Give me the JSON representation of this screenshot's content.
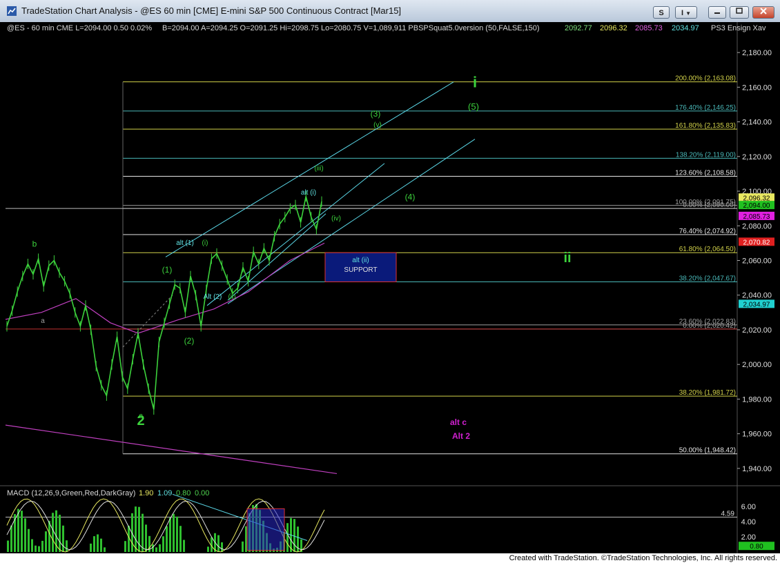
{
  "window": {
    "title": "TradeStation Chart Analysis - @ES 60 min [CME] E-mini S&P 500 Continuous Contract [Mar15]",
    "buttons": [
      {
        "name": "symbol-button",
        "label": "S"
      },
      {
        "name": "indicator-button",
        "label": "I"
      }
    ]
  },
  "header": [
    {
      "text": "@ES - 60 min  CME  L=2094.00  0.50   0.02%",
      "color": "#d8d8d8"
    },
    {
      "text": "B=2094.00  A=2094.25  O=2091.25  Hi=2098.75  Lo=2080.75  V=1,089,911  PBSPSquat5.0version (50,FALSE,150)",
      "color": "#d8d8d8"
    },
    {
      "text": "2092.77",
      "color": "#7fe07f"
    },
    {
      "text": "2096.32",
      "color": "#e8e860"
    },
    {
      "text": "2085.73",
      "color": "#e060e0"
    },
    {
      "text": "2034.97",
      "color": "#60e0e0"
    },
    {
      "text": "PS3 Ensign Xav",
      "color": "#d8d8d8"
    }
  ],
  "macd_header": [
    {
      "text": "MACD (12,26,9,Green,Red,DarkGray)",
      "color": "#d8d8d8"
    },
    {
      "text": "1.90",
      "color": "#e8e860"
    },
    {
      "text": "1.09",
      "color": "#60e0e0"
    },
    {
      "text": "0.80",
      "color": "#4fd24f"
    },
    {
      "text": "0.00",
      "color": "#4fd24f"
    }
  ],
  "footer": "Created with TradeStation. ©TradeStation Technologies, Inc. All rights reserved.",
  "chart_data": {
    "type": "line",
    "series": [
      {
        "values": [
          2022,
          2031,
          2042,
          2051,
          2058,
          2052,
          2061,
          2045,
          2057,
          2060,
          2053,
          2048,
          2041,
          2030,
          2022,
          2034,
          2020,
          1999,
          1988,
          1982,
          2000,
          2016,
          1993,
          1986,
          2003,
          2018,
          2000,
          1986,
          1974,
          2013,
          2024,
          2035,
          2046,
          2044,
          2030,
          2051,
          2040,
          2022,
          2043,
          2061,
          2064,
          2057,
          2049,
          2041,
          2044,
          2056,
          2048,
          2065,
          2058,
          2067,
          2060,
          2074,
          2081,
          2085,
          2090,
          2092,
          2082,
          2097,
          2085,
          2078,
          2094
        ],
        "color": "#3cd23c"
      }
    ],
    "ylim": [
      1930,
      2192
    ],
    "y_ticks": [
      "2,180.00",
      "2,160.00",
      "2,140.00",
      "2,120.00",
      "2,100.00",
      "2,080.00",
      "2,060.00",
      "2,040.00",
      "2,020.00",
      "2,000.00",
      "1,980.00",
      "1,960.00",
      "1,940.00"
    ],
    "fib_levels": [
      {
        "label": "200.00% (2,163.08)",
        "value": 2163.08,
        "color": "#d2d24a"
      },
      {
        "label": "176.40% (2,146.25)",
        "value": 2146.25,
        "color": "#4ab9b9"
      },
      {
        "label": "161.80% (2,135.83)",
        "value": 2135.83,
        "color": "#d2d24a"
      },
      {
        "label": "138.20% (2,119.00)",
        "value": 2119.0,
        "color": "#4ab9b9"
      },
      {
        "label": "123.60% (2,108.58)",
        "value": 2108.58,
        "color": "#e6e6e6"
      },
      {
        "label": "100.00% (2,091.75)",
        "value": 2091.75,
        "color": "#a0a0a0"
      },
      {
        "label": "0.00% (2,090.00)",
        "value": 2090.0,
        "color": "#a0a0a0"
      },
      {
        "label": "76.40% (2,074.92)",
        "value": 2074.92,
        "color": "#e6e6e6"
      },
      {
        "label": "61.80% (2,064.50)",
        "value": 2064.5,
        "color": "#d2d24a"
      },
      {
        "label": "38.20% (2,047.67)",
        "value": 2047.67,
        "color": "#4ab9b9"
      },
      {
        "label": "23.60% (2,022.83)",
        "value": 2022.83,
        "color": "#a0a0a0"
      },
      {
        "label": "0.00% (2,020.42)",
        "value": 2020.42,
        "color": "#a0a0a0"
      },
      {
        "label": "38.20% (1,981.72)",
        "value": 1981.72,
        "color": "#d2d24a"
      },
      {
        "label": "50.00% (1,948.42)",
        "value": 1948.42,
        "color": "#e6e6e6"
      }
    ],
    "price_tags": [
      {
        "text": "2,096.32",
        "value": 2096.32,
        "bg": "#e8e860",
        "fg": "#000"
      },
      {
        "text": "2,094.00",
        "value": 2092.0,
        "bg": "#20c020",
        "fg": "#000"
      },
      {
        "text": "2,085.73",
        "value": 2085.73,
        "bg": "#e020e0",
        "fg": "#000"
      },
      {
        "text": "2,070.82",
        "value": 2070.82,
        "bg": "#e02020",
        "fg": "#fff"
      },
      {
        "text": "2,034.97",
        "value": 2034.97,
        "bg": "#20d0d0",
        "fg": "#000"
      }
    ],
    "wave_labels": [
      {
        "text": "i",
        "value": 2160,
        "color": "#3cd23c"
      },
      {
        "text": "(5)",
        "value": 2147,
        "color": "#3cd23c"
      },
      {
        "text": "(3)",
        "value": 2143,
        "color": "#3cd23c"
      },
      {
        "text": "(v)",
        "value": 2137,
        "color": "#3cd23c"
      },
      {
        "text": "(iii)",
        "value": 2112,
        "color": "#3cd23c"
      },
      {
        "text": "alt (i)",
        "value": 2098,
        "color": "#60e0e0"
      },
      {
        "text": "(4)",
        "value": 2095,
        "color": "#3cd23c"
      },
      {
        "text": "(iv)",
        "value": 2083,
        "color": "#3cd23c"
      },
      {
        "text": "b",
        "value": 2068,
        "color": "#3cd23c"
      },
      {
        "text": "alt (1)",
        "value": 2069,
        "color": "#60e0e0"
      },
      {
        "text": "(i)",
        "value": 2069,
        "color": "#3cd23c"
      },
      {
        "text": "(1)",
        "value": 2053,
        "color": "#3cd23c"
      },
      {
        "text": "ii",
        "value": 2059,
        "color": "#3cd23c"
      },
      {
        "text": "Alt (2)",
        "value": 2038,
        "color": "#60e0e0"
      },
      {
        "text": "(ii)",
        "value": 2038,
        "color": "#3cd23c"
      },
      {
        "text": "a",
        "value": 2024,
        "color": "#a0a0a0"
      },
      {
        "text": "(2)",
        "value": 2012,
        "color": "#3cd23c"
      },
      {
        "text": "c",
        "value": 1969,
        "color": "#3cd23c"
      },
      {
        "text": "2",
        "value": 1965,
        "color": "#3cd23c"
      },
      {
        "text": "alt c",
        "value": 1965,
        "color": "#d020d0"
      },
      {
        "text": "Alt 2",
        "value": 1957,
        "color": "#d020d0"
      }
    ],
    "support_box": {
      "label1": "alt (ii)",
      "label2": "SUPPORT",
      "top": 2064.5,
      "bottom": 2047.67
    },
    "macd": {
      "ylim": [
        0,
        8
      ],
      "y_ticks": [
        "6.00",
        "4.00",
        "2.00"
      ],
      "tags": [
        {
          "text": "4.59",
          "value": 4.59
        },
        {
          "text": "0.80",
          "value": 0.8
        }
      ]
    }
  }
}
